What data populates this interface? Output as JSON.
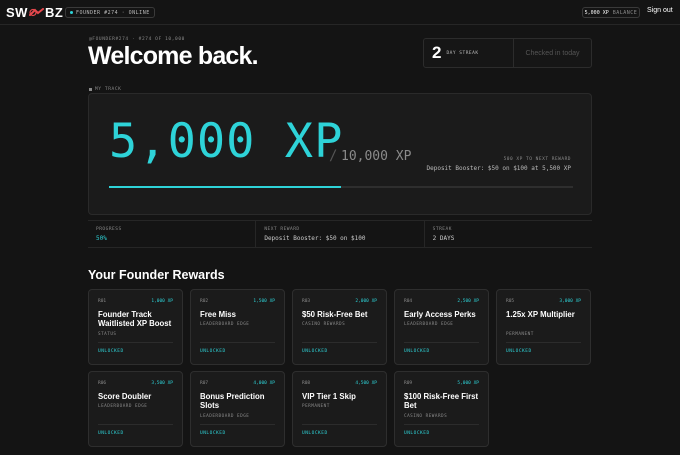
{
  "brand": {
    "logo_left": "SW",
    "logo_right": "BZ"
  },
  "topbar": {
    "founder_badge": "FOUNDER #274 · ONLINE",
    "xp_value": "5,000 XP",
    "xp_label": "BALANCE",
    "signout": "Sign out"
  },
  "header": {
    "eyebrow": "@FOUNDER#274 · #274 OF 10,000",
    "welcome": "Welcome back.",
    "streak_num": "2",
    "streak_label": "DAY STREAK",
    "checked_in": "Checked in today"
  },
  "track": {
    "label": "MY TRACK",
    "xp_current": "5,000 XP",
    "slash": "/",
    "xp_target": "10,000 XP",
    "next_hint": "500 XP TO NEXT REWARD",
    "next_desc": "Deposit Booster: $50 on $100 at 5,500 XP",
    "progress_fraction": 0.5
  },
  "stats": [
    {
      "label": "PROGRESS",
      "value": "50%",
      "accent": true
    },
    {
      "label": "NEXT REWARD",
      "value": "Deposit Booster: $50 on $100",
      "accent": false
    },
    {
      "label": "STREAK",
      "value": "2 DAYS",
      "accent": false
    }
  ],
  "rewards": {
    "title": "Your Founder Rewards",
    "items": [
      {
        "num": "R01",
        "xp": "1,000 XP",
        "name": "Founder Track Waitlisted XP Boost",
        "category": "STATUS",
        "status": "UNLOCKED"
      },
      {
        "num": "R02",
        "xp": "1,500 XP",
        "name": "Free Miss",
        "category": "LEADERBOARD EDGE",
        "status": "UNLOCKED"
      },
      {
        "num": "R03",
        "xp": "2,000 XP",
        "name": "$50 Risk-Free Bet",
        "category": "CASINO REWARDS",
        "status": "UNLOCKED"
      },
      {
        "num": "R04",
        "xp": "2,500 XP",
        "name": "Early Access Perks",
        "category": "LEADERBOARD EDGE",
        "status": "UNLOCKED"
      },
      {
        "num": "R05",
        "xp": "3,000 XP",
        "name": "1.25x XP Multiplier",
        "category": "PERMANENT",
        "status": "UNLOCKED"
      },
      {
        "num": "R06",
        "xp": "3,500 XP",
        "name": "Score Doubler",
        "category": "LEADERBOARD EDGE",
        "status": "UNLOCKED"
      },
      {
        "num": "R07",
        "xp": "4,000 XP",
        "name": "Bonus Prediction Slots",
        "category": "LEADERBOARD EDGE",
        "status": "UNLOCKED"
      },
      {
        "num": "R08",
        "xp": "4,500 XP",
        "name": "VIP Tier 1 Skip",
        "category": "PERMANENT",
        "status": "UNLOCKED"
      },
      {
        "num": "R09",
        "xp": "5,000 XP",
        "name": "$100 Risk-Free First Bet",
        "category": "CASINO REWARDS",
        "status": "UNLOCKED"
      }
    ]
  },
  "colors": {
    "accent": "#2ed3d8",
    "logo_mark": "#e5484d",
    "background": "#141414"
  }
}
